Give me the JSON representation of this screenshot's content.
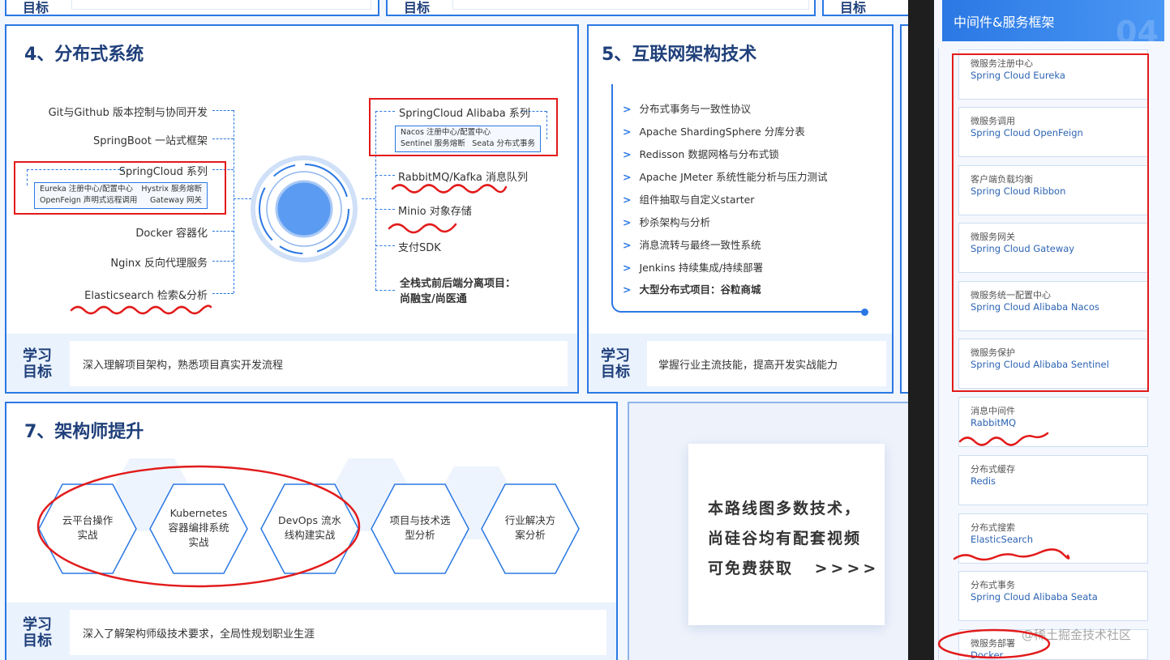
{
  "sections": {
    "distributed": {
      "title": "4、分布式系统",
      "left_items": [
        "Git与Github 版本控制与协同开发",
        "SpringBoot 一站式框架",
        "SpringCloud 系列",
        "Docker 容器化",
        "Nginx 反向代理服务",
        "Elasticsearch 检索&分析"
      ],
      "springcloud_sub": [
        "Eureka 注册中心/配置中心",
        "Hystrix 服务熔断",
        "OpenFeign 声明式远程调用",
        "Gateway 网关"
      ],
      "alibaba_title": "SpringCloud Alibaba 系列",
      "alibaba_sub": [
        "Nacos 注册中心/配置中心",
        "Sentinel 服务熔断",
        "Seata 分布式事务"
      ],
      "right_items": [
        "RabbitMQ/Kafka 消息队列",
        "Minio 对象存储",
        "支付SDK"
      ],
      "project_line1": "全栈式前后端分离项目：",
      "project_line2": "尚融宝/尚医通",
      "goal_label_1": "学习",
      "goal_label_2": "目标",
      "goal_text": "深入理解项目架构，熟悉项目真实开发流程"
    },
    "internet": {
      "title": "5、互联网架构技术",
      "items": [
        "分布式事务与一致性协议",
        "Apache ShardingSphere 分库分表",
        "Redisson 数据网格与分布式锁",
        "Apache JMeter 系统性能分析与压力测试",
        "组件抽取与自定义starter",
        "秒杀架构与分析",
        "消息流转与最终一致性系统",
        "Jenkins 持续集成/持续部署",
        "大型分布式项目：谷粒商城"
      ],
      "arrow": ">",
      "goal_label_1": "学习",
      "goal_label_2": "目标",
      "goal_text": "掌握行业主流技能，提高开发实战能力"
    },
    "architect": {
      "title": "7、架构师提升",
      "hexagons": [
        {
          "line1": "云平台操作",
          "line2": "实战",
          "line3": ""
        },
        {
          "line1": "Kubernetes",
          "line2": "容器编排系统",
          "line3": "实战"
        },
        {
          "line1": "DevOps 流水",
          "line2": "线构建实战",
          "line3": ""
        },
        {
          "line1": "项目与技术选",
          "line2": "型分析",
          "line3": ""
        },
        {
          "line1": "行业解决方",
          "line2": "案分析",
          "line3": ""
        }
      ],
      "goal_label_1": "学习",
      "goal_label_2": "目标",
      "goal_text": "深入了解架构师级技术要求，全局性规划职业生涯"
    },
    "promo": {
      "line1": "本路线图多数技术，",
      "line2": "尚硅谷均有配套视频",
      "line3": "可免费获取",
      "arrows": ">>>>"
    }
  },
  "top_fragment": {
    "label": "目标"
  },
  "sidebar": {
    "header": "中间件&服务框架",
    "header_num": "04",
    "items": [
      {
        "t1": "微服务注册中心",
        "t2": "Spring Cloud Eureka"
      },
      {
        "t1": "微服务调用",
        "t2": "Spring Cloud OpenFeign"
      },
      {
        "t1": "客户端负载均衡",
        "t2": "Spring Cloud Ribbon"
      },
      {
        "t1": "微服务网关",
        "t2": "Spring Cloud Gateway"
      },
      {
        "t1": "微服务统一配置中心",
        "t2": "Spring Cloud Alibaba Nacos"
      },
      {
        "t1": "微服务保护",
        "t2": "Spring Cloud Alibaba Sentinel"
      },
      {
        "t1": "消息中间件",
        "t2": "RabbitMQ"
      },
      {
        "t1": "分布式缓存",
        "t2": "Redis"
      },
      {
        "t1": "分布式搜索",
        "t2": "ElasticSearch"
      },
      {
        "t1": "分布式事务",
        "t2": "Spring Cloud Alibaba Seata"
      },
      {
        "t1": "微服务部署",
        "t2": "Docker"
      }
    ]
  },
  "watermark": "@稀土掘金技术社区",
  "colors": {
    "accent": "#2b78e4",
    "annotation": "#e21b1b",
    "title": "#1f3f7a"
  }
}
